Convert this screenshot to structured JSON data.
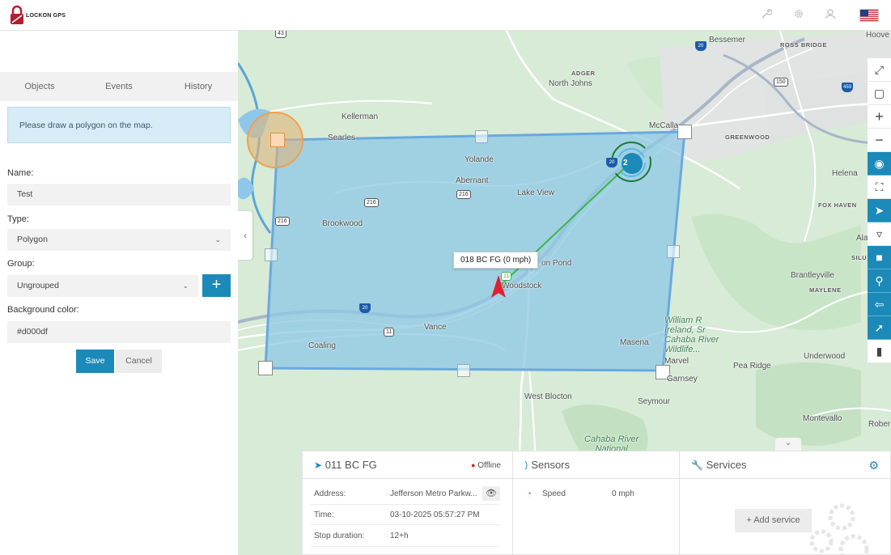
{
  "brand": {
    "logo_text": "LOCKON GPS"
  },
  "topbar": {
    "icons": [
      "wrench-icon",
      "gear-icon",
      "user-icon"
    ],
    "flag": "us-flag-icon"
  },
  "tabs": [
    {
      "label": "Objects"
    },
    {
      "label": "Events"
    },
    {
      "label": "History"
    }
  ],
  "form": {
    "notice": "Please draw a polygon on the map.",
    "name_label": "Name:",
    "name_value": "Test",
    "type_label": "Type:",
    "type_value": "Polygon",
    "group_label": "Group:",
    "group_value": "Ungrouped",
    "bg_label": "Background color:",
    "bg_value": "#d000df",
    "save_label": "Save",
    "cancel_label": "Cancel"
  },
  "map": {
    "tooltip": "018 BC FG (0 mph)",
    "cluster_count": "2",
    "labels": {
      "bessemer": "Bessemer",
      "ross_bridge": "ROSS BRIDGE",
      "hoover": "Hoove",
      "adger": "ADGER",
      "north_johns": "North Johns",
      "kellerman": "Kellerman",
      "searles": "Searles",
      "mccalla": "McCalla",
      "greenwood": "GREENWOOD",
      "yolande": "Yolande",
      "abernant": "Abernant",
      "lake_view": "Lake View",
      "helena": "Helena",
      "fox_haven": "FOX HAVEN",
      "ala": "Ala",
      "silu": "SILU",
      "brookwood": "Brookwood",
      "pond": "on Pond",
      "woodstock": "Woodstock",
      "brantleyville": "Brantleyville",
      "maylene": "MAYLENE",
      "william_r": "William R\nIreland, Sr\nCahaba River\nWildlife...",
      "vance": "Vance",
      "coaling": "Coaling",
      "masena": "Masena",
      "marvel": "Marvel",
      "gurnsey": "Garnsey",
      "underwood": "Underwood",
      "pea_ridge": "Pea Ridge",
      "west_blocton": "West Blocton",
      "seymour": "Seymour",
      "montevallo": "Montevallo",
      "roberts": "Rober",
      "cahaba_river": "Cahaba River\nNational"
    },
    "shields": {
      "r43": "43",
      "r20": "20",
      "r150": "150",
      "r459": "459",
      "r216a": "216",
      "r216b": "216",
      "r216c": "216",
      "r20b": "20",
      "r11": "11",
      "r11b": "11",
      "r20c": "20"
    }
  },
  "object_panel": {
    "title": "011 BC FG",
    "status": "Offline",
    "status_color": "#e02020",
    "rows": [
      {
        "label": "Address:",
        "value": "Jefferson Metro Parkw..."
      },
      {
        "label": "Time:",
        "value": "03-10-2025 05:57:27 PM"
      },
      {
        "label": "Stop duration:",
        "value": "12+h"
      }
    ]
  },
  "sensors_panel": {
    "title": "Sensors",
    "rows": [
      {
        "label": "Speed",
        "value": "0 mph"
      }
    ]
  },
  "services_panel": {
    "title": "Services",
    "add_label": "Add service"
  },
  "colors": {
    "accent": "#1b8ab8",
    "polygon_fill": "#8ec8e6",
    "polygon_stroke": "#6aa8e0",
    "track": "#3cb54a",
    "marker": "#e0202f"
  }
}
